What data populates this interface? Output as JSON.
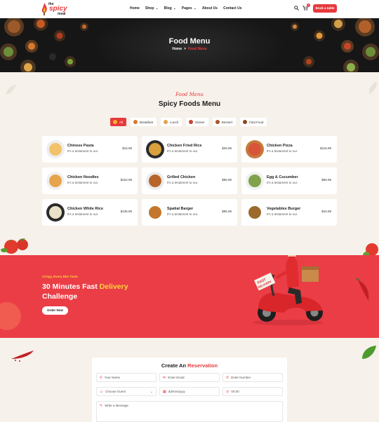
{
  "header": {
    "logo": {
      "the": "the",
      "spicy": "spicy",
      "meal": "meal"
    },
    "nav": [
      {
        "label": "Home",
        "dropdown": false
      },
      {
        "label": "Shop",
        "dropdown": true
      },
      {
        "label": "Blog",
        "dropdown": true
      },
      {
        "label": "Pages",
        "dropdown": true
      },
      {
        "label": "About Us",
        "dropdown": false
      },
      {
        "label": "Contact Us",
        "dropdown": false
      }
    ],
    "cart_count": "0",
    "book_label": "Book a table",
    "icons": [
      "search-icon",
      "cart-icon"
    ]
  },
  "hero": {
    "title": "Food Menu",
    "breadcrumb_home": "Home",
    "breadcrumb_sep": ">",
    "breadcrumb_current": "Food Menu"
  },
  "menu": {
    "subtitle": "Food Menu",
    "title": "Spicy Foods Menu",
    "filters": [
      {
        "label": "All",
        "active": true
      },
      {
        "label": "Breakfast",
        "active": false
      },
      {
        "label": "Lunch",
        "active": false
      },
      {
        "label": "Dinner",
        "active": false
      },
      {
        "label": "Dessert",
        "active": false
      },
      {
        "label": "Fast Food",
        "active": false
      }
    ],
    "items": [
      {
        "name": "Chinese Pasta",
        "desc": "It's a testament to our.",
        "price": "$15.99"
      },
      {
        "name": "Chicken Fried Rice",
        "desc": "It's a testament to our.",
        "price": "$25.99"
      },
      {
        "name": "Chicken Pizza",
        "desc": "It's a testament to our.",
        "price": "$115.99"
      },
      {
        "name": "Chicken Noodles",
        "desc": "It's a testament to our.",
        "price": "$154.99"
      },
      {
        "name": "Grilled Chicken",
        "desc": "It's a testament to our.",
        "price": "$55.99"
      },
      {
        "name": "Egg & Cucumber",
        "desc": "It's a testament to our.",
        "price": "$65.99"
      },
      {
        "name": "Chicken White Rice",
        "desc": "It's a testament to our.",
        "price": "$135.99"
      },
      {
        "name": "Spatial Barger",
        "desc": "It's a testament to our.",
        "price": "$95.99"
      },
      {
        "name": "Vegetables Burger",
        "desc": "It's a testament to our.",
        "price": "$15.99"
      }
    ]
  },
  "banner": {
    "kicker": "Crispy, Every Bite Taste",
    "headline_1": "30 Minutes Fast",
    "headline_accent": "Delivery",
    "headline_2": "Challenge",
    "cta": "Order Now",
    "box_text": "FAST DELIVERY"
  },
  "reservation": {
    "title_1": "Create An",
    "title_accent": "Reservation",
    "fields": {
      "name": "Your Name",
      "email": "Enter Email",
      "phone": "Enter Number",
      "guest": "Choose Guest",
      "date": "dd/mm/yyyy",
      "time": "00.00",
      "message": "Write a Message"
    }
  },
  "colors": {
    "accent": "#e63a3d",
    "banner": "#ea3d46",
    "highlight": "#ffd33d",
    "page_bg": "#f6f1ea"
  }
}
